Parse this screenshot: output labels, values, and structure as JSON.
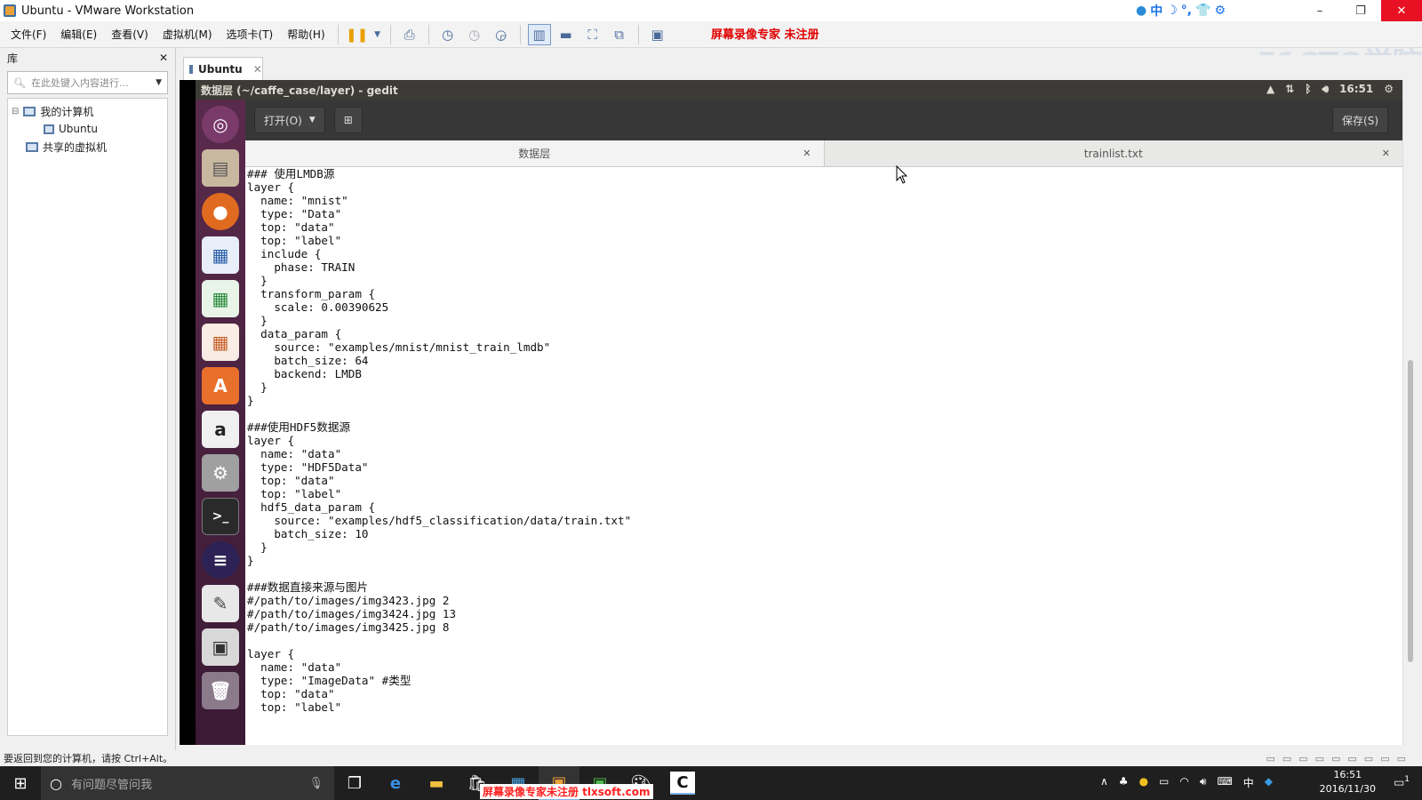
{
  "window": {
    "title": "Ubuntu - VMware Workstation",
    "controls": [
      "–",
      "❐",
      "✕"
    ]
  },
  "ime_tray": [
    "中",
    "☽",
    "°,",
    "👕",
    "⚙"
  ],
  "menu": [
    "文件(F)",
    "编辑(E)",
    "查看(V)",
    "虚拟机(M)",
    "选项卡(T)",
    "帮助(H)"
  ],
  "toolbar_icons": [
    "pause-icon",
    "dropdown-icon",
    "send-ctrl-alt-del-icon",
    "snapshot-icon",
    "snapshot-restore-icon",
    "snapshot-manager-icon",
    "view-library-icon",
    "view-thumbnail-icon",
    "fullscreen-icon",
    "unity-icon",
    "console-view-icon"
  ],
  "watermark_top": "屏幕录像专家  未注册",
  "logo_text": "51CTO学院",
  "library": {
    "header": "库",
    "search_placeholder": "在此处键入内容进行...",
    "tree": {
      "my_computer": "我的计算机",
      "vm": "Ubuntu",
      "shared": "共享的虚拟机"
    }
  },
  "vm_tab": {
    "label": "Ubuntu"
  },
  "ubuntu_panel": {
    "title": "数据层 (~/caffe_case/layer) - gedit",
    "time": "16:51"
  },
  "gedit": {
    "open_label": "打开(O)",
    "save_label": "保存(S)",
    "tabs": [
      {
        "label": "数据层",
        "active": true
      },
      {
        "label": "trainlist.txt",
        "active": false
      }
    ],
    "code": "### 使用LMDB源\nlayer {\n  name: \"mnist\"\n  type: \"Data\"\n  top: \"data\"\n  top: \"label\"\n  include {\n    phase: TRAIN\n  }\n  transform_param {\n    scale: 0.00390625\n  }\n  data_param {\n    source: \"examples/mnist/mnist_train_lmdb\"\n    batch_size: 64\n    backend: LMDB\n  }\n}\n\n###使用HDF5数据源\nlayer {\n  name: \"data\"\n  type: \"HDF5Data\"\n  top: \"data\"\n  top: \"label\"\n  hdf5_data_param {\n    source: \"examples/hdf5_classification/data/train.txt\"\n    batch_size: 10\n  }\n}\n\n###数据直接来源与图片\n#/path/to/images/img3423.jpg 2\n#/path/to/images/img3424.jpg 13\n#/path/to/images/img3425.jpg 8\n\nlayer {\n  name: \"data\"\n  type: \"ImageData\" #类型\n  top: \"data\"\n  top: \"label\""
  },
  "status_text": "要返回到您的计算机，请按 Ctrl+Alt。",
  "taskbar": {
    "search_placeholder": "有问题尽管问我",
    "clock_time": "16:51",
    "clock_date": "2016/11/30",
    "ime": "中",
    "notification_count": "1"
  },
  "watermark_bottom": "屏幕录像专家未注册 tlxsoft.com"
}
